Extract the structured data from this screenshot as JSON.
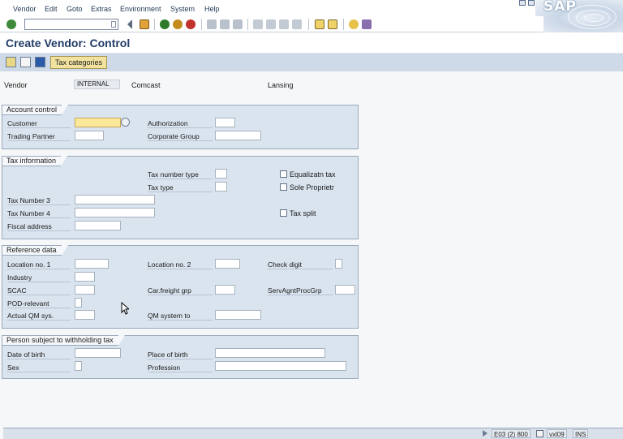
{
  "menu": {
    "items": [
      "Vendor",
      "Edit",
      "Goto",
      "Extras",
      "Environment",
      "System",
      "Help"
    ],
    "logo": "SAP"
  },
  "toolbar": {
    "command_value": "",
    "icons": [
      "enter-icon",
      "back-icon",
      "save-icon",
      "back-arrow-icon",
      "exit-icon",
      "cancel-icon",
      "print-icon",
      "find-icon",
      "find-next-icon",
      "first-page-icon",
      "prev-page-icon",
      "next-page-icon",
      "last-page-icon",
      "new-session-icon",
      "shortcut-icon",
      "help-icon",
      "layout-menu-icon"
    ]
  },
  "page": {
    "title": "Create Vendor: Control"
  },
  "app_toolbar": {
    "tax_categories_label": "Tax categories"
  },
  "header": {
    "vendor_label": "Vendor",
    "vendor_value": "INTERNAL",
    "name": "Comcast",
    "city": "Lansing"
  },
  "account_control": {
    "title": "Account control",
    "customer_label": "Customer",
    "customer_value": "",
    "authorization_label": "Authorization",
    "trading_partner_label": "Trading Partner",
    "corporate_group_label": "Corporate Group"
  },
  "tax_information": {
    "title": "Tax information",
    "tax_number_type_label": "Tax number type",
    "tax_type_label": "Tax type",
    "equalizatn_tax_label": "Equalizatn tax",
    "sole_proprietr_label": "Sole Proprietr",
    "tax_number_3_label": "Tax Number 3",
    "tax_number_4_label": "Tax Number 4",
    "tax_split_label": "Tax split",
    "fiscal_address_label": "Fiscal address"
  },
  "reference_data": {
    "title": "Reference data",
    "location_no_1_label": "Location no. 1",
    "location_no_2_label": "Location no. 2",
    "check_digit_label": "Check digit",
    "industry_label": "Industry",
    "scac_label": "SCAC",
    "car_freight_grp_label": "Car.freight grp",
    "serv_agnt_proc_grp_label": "ServAgntProcGrp",
    "pod_relevant_label": "POD-relevant",
    "actual_qm_sys_label": "Actual QM sys.",
    "qm_system_to_label": "QM system to"
  },
  "person_withholding": {
    "title": "Person subject to withholding tax",
    "date_of_birth_label": "Date of birth",
    "place_of_birth_label": "Place of birth",
    "sex_label": "Sex",
    "profession_label": "Profession"
  },
  "status_bar": {
    "system": "E03 (2) 800",
    "server": "vxl09",
    "mode": "INS"
  },
  "colors": {
    "group_bg": "#dae4ef",
    "required_field": "#fbe89b",
    "title": "#1f3b66"
  }
}
